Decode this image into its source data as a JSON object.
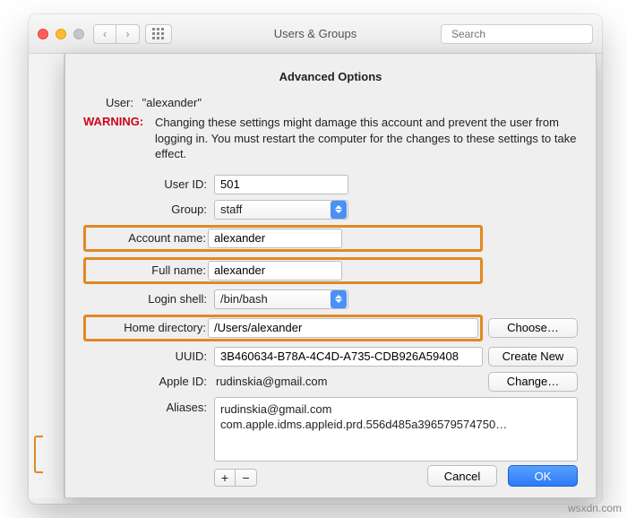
{
  "titlebar": {
    "title": "Users & Groups",
    "search_placeholder": "Search"
  },
  "sheet": {
    "heading": "Advanced Options",
    "user_label": "User:",
    "user_value": "\"alexander\"",
    "warning_label": "WARNING:",
    "warning_text": "Changing these settings might damage this account and prevent the user from logging in. You must restart the computer for the changes to these settings to take effect."
  },
  "fields": {
    "user_id": {
      "label": "User ID:",
      "value": "501"
    },
    "group": {
      "label": "Group:",
      "value": "staff"
    },
    "account_name": {
      "label": "Account name:",
      "value": "alexander"
    },
    "full_name": {
      "label": "Full name:",
      "value": "alexander"
    },
    "login_shell": {
      "label": "Login shell:",
      "value": "/bin/bash"
    },
    "home_dir": {
      "label": "Home directory:",
      "value": "/Users/alexander"
    },
    "uuid": {
      "label": "UUID:",
      "value": "3B460634-B78A-4C4D-A735-CDB926A59408"
    },
    "apple_id": {
      "label": "Apple ID:",
      "value": "rudinskia@gmail.com"
    },
    "aliases": {
      "label": "Aliases:",
      "items": [
        "rudinskia@gmail.com",
        "com.apple.idms.appleid.prd.556d485a396579574750…"
      ]
    }
  },
  "buttons": {
    "choose": "Choose…",
    "create_new": "Create New",
    "change": "Change…",
    "cancel": "Cancel",
    "ok": "OK",
    "plus": "+",
    "minus": "−"
  },
  "watermark": "wsxdn.com"
}
